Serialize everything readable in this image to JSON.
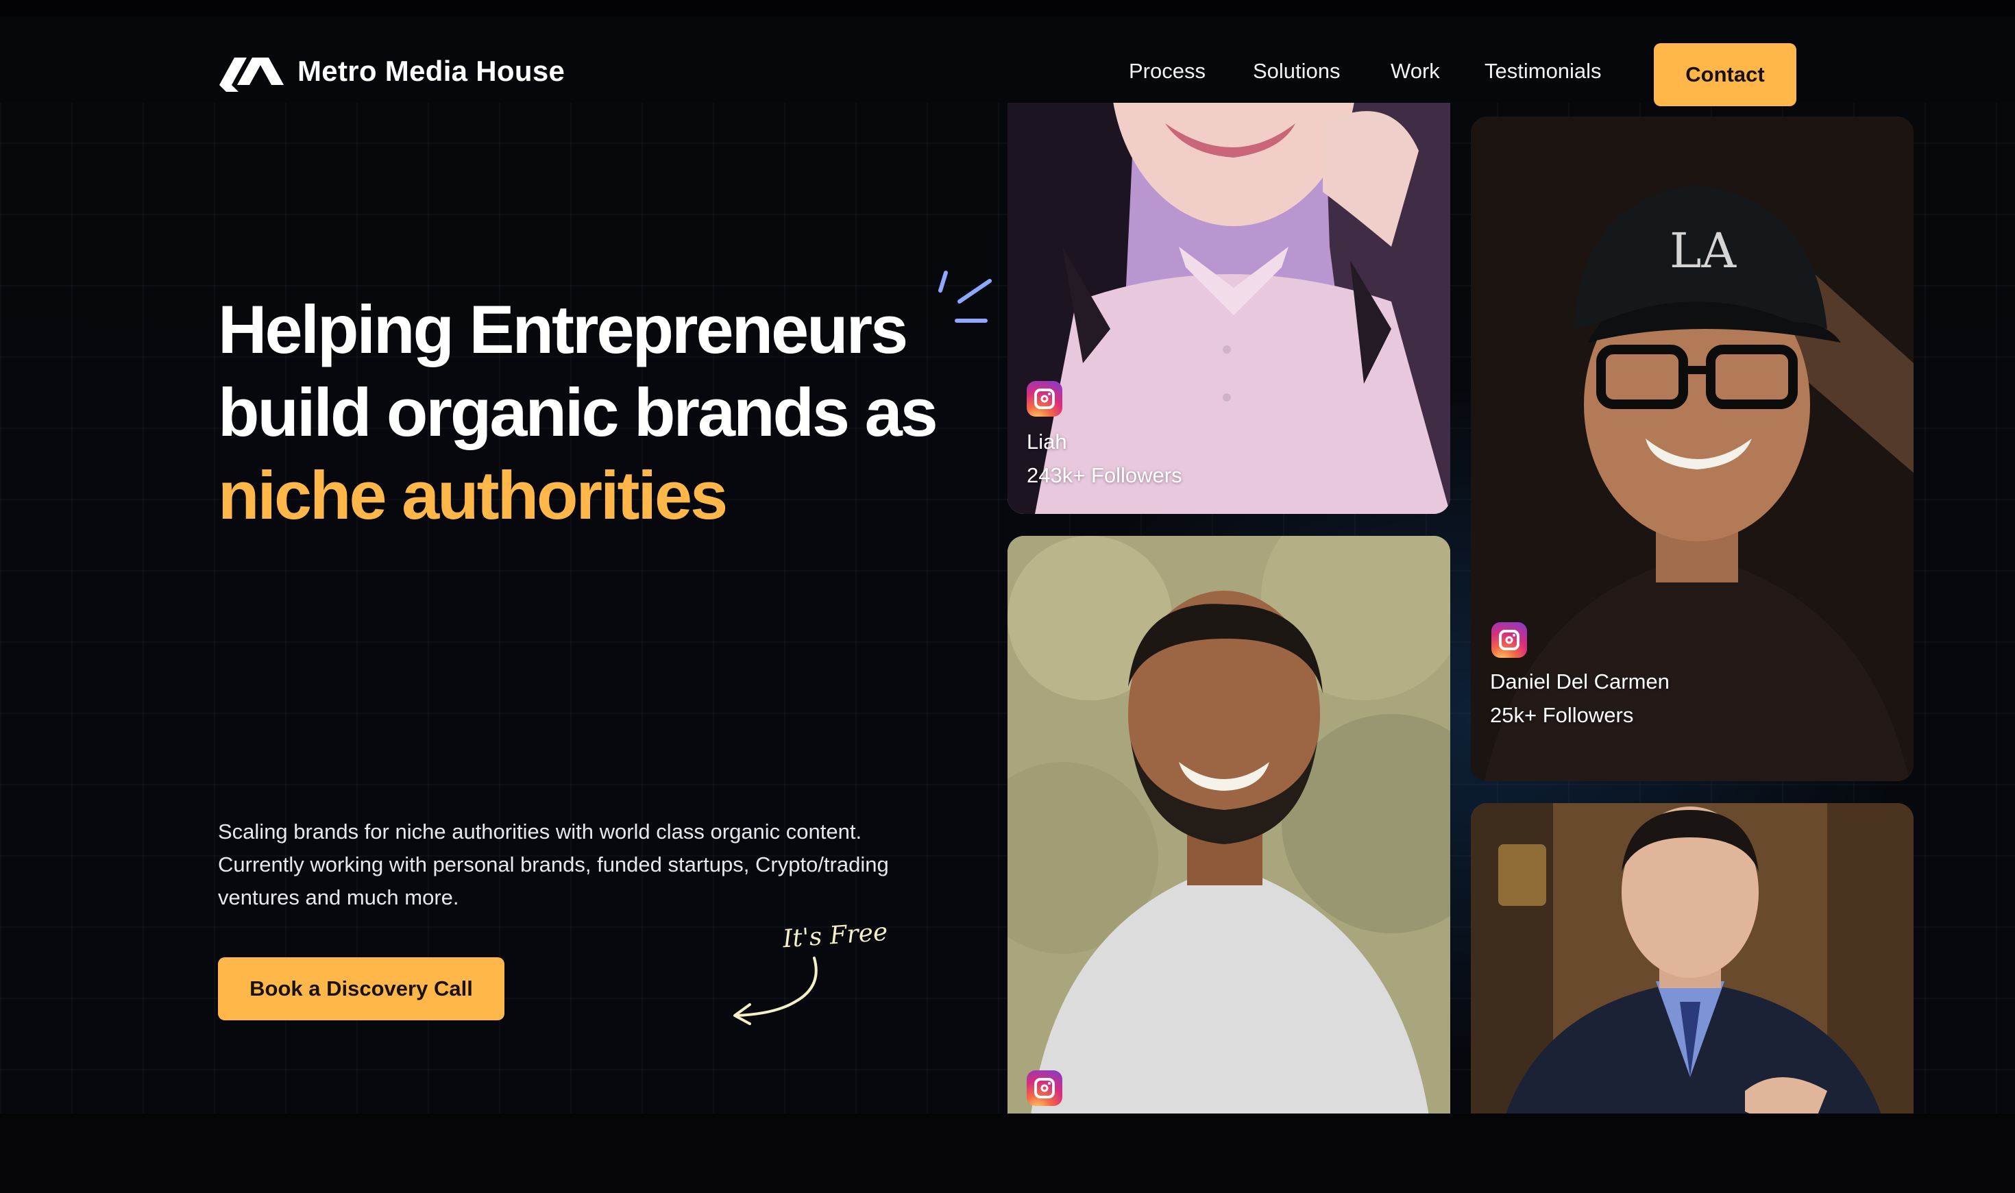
{
  "nav": {
    "brand": "Metro Media House",
    "links": [
      "Process",
      "Solutions",
      "Work",
      "Testimonials"
    ],
    "contact": "Contact"
  },
  "hero": {
    "headline_line1": "Helping Entrepreneurs",
    "headline_line2": "build organic brands as",
    "headline_accent": "niche authorities",
    "subtext": "Scaling brands for niche authorities with world class organic content. Currently working with personal brands, funded startups, Crypto/trading ventures and much more.",
    "cta": "Book a Discovery Call",
    "free_note": "It's Free"
  },
  "creators": [
    {
      "name": "Liah",
      "followers": "243k+ Followers"
    },
    {
      "name": "Daniel Del Carmen",
      "followers": "25k+ Followers"
    }
  ],
  "icons": [
    "logo-mark-icon",
    "instagram-icon",
    "curved-arrow-icon",
    "sparkle-lines-icon"
  ],
  "colors": {
    "accent": "#ffb74a",
    "background": "#06070b"
  }
}
